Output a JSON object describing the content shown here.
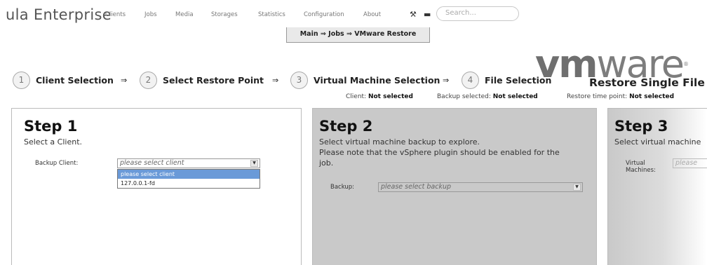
{
  "app": {
    "title": "ula Enterprise"
  },
  "nav": {
    "items": [
      "Clients",
      "Jobs",
      "Media",
      "Storages",
      "Statistics",
      "Configuration",
      "About"
    ],
    "search_placeholder": "Search..."
  },
  "breadcrumb": "Main ⇒ Jobs ⇒ VMware Restore",
  "logo": {
    "vm": "vm",
    "ware": "ware",
    "reg": "®"
  },
  "page_title": "Restore Single File",
  "wizard": {
    "steps": [
      {
        "num": "1",
        "label": "Client Selection"
      },
      {
        "num": "2",
        "label": "Select Restore Point"
      },
      {
        "num": "3",
        "label": "Virtual Machine Selection"
      },
      {
        "num": "4",
        "label": "File Selection"
      }
    ],
    "arrow": "⇒"
  },
  "status": {
    "client_label": "Client:",
    "client_value": "Not selected",
    "backup_label": "Backup selected:",
    "backup_value": "Not selected",
    "time_label": "Restore time point:",
    "time_value": "Not selected"
  },
  "panels": {
    "step1": {
      "title": "Step 1",
      "desc": "Select a Client.",
      "field_label": "Backup Client:",
      "select_value": "please select client",
      "options": [
        "please select client",
        "127.0.0.1-fd"
      ]
    },
    "step2": {
      "title": "Step 2",
      "desc_line1": "Select virtual machine backup to explore.",
      "desc_line2": "Please note that the vSphere plugin should be enabled for the",
      "desc_line3": "job.",
      "field_label": "Backup:",
      "select_value": "please select backup"
    },
    "step3": {
      "title": "Step 3",
      "desc": "Select virtual machine",
      "field_label_1": "Virtual",
      "field_label_2": "Machines:",
      "select_value": "please"
    }
  },
  "colors": {
    "dropdown_highlight": "#6a9ad8",
    "panel_grey": "#c9c9c9"
  }
}
